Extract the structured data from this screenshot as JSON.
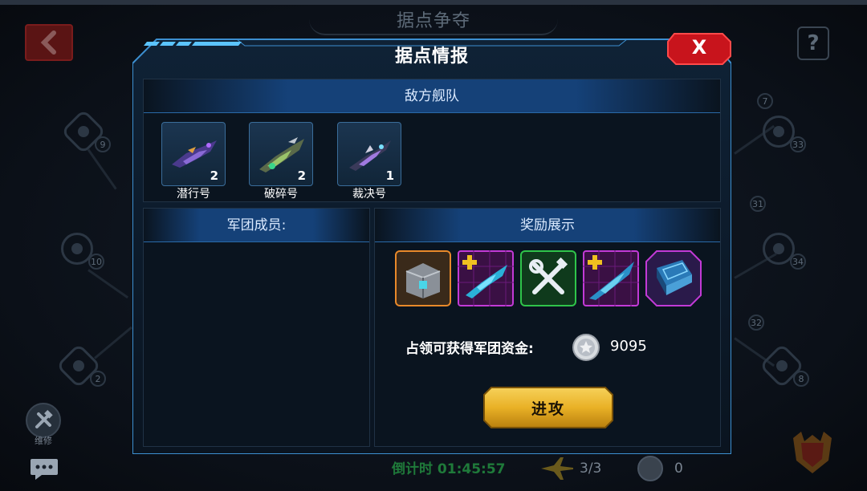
{
  "background": {
    "screen_title": "据点争夺",
    "help_glyph": "?",
    "nodes": [
      {
        "number": "9"
      },
      {
        "number": "10"
      },
      {
        "number": "2"
      },
      {
        "number": "7"
      },
      {
        "number": "33"
      },
      {
        "number": "31"
      },
      {
        "number": "34"
      },
      {
        "number": "32"
      },
      {
        "number": "8"
      }
    ],
    "repair_label": "维修",
    "countdown": "倒计时 01:45:57",
    "attempts": "3/3",
    "coins": "0"
  },
  "dialog": {
    "title": "据点情报",
    "close_label": "X",
    "enemy_fleet": {
      "header": "敌方舰队",
      "ships": [
        {
          "name": "潜行号",
          "count": "2",
          "icon": "purple-frigate-icon"
        },
        {
          "name": "破碎号",
          "count": "2",
          "icon": "green-cruiser-icon"
        },
        {
          "name": "裁决号",
          "count": "1",
          "icon": "violet-destroyer-icon"
        }
      ]
    },
    "members": {
      "header": "军团成员:"
    },
    "rewards": {
      "header": "奖励展示",
      "items": [
        {
          "icon": "supply-crate-icon",
          "rarity_color": "#e8892a"
        },
        {
          "icon": "ship-fragment-icon",
          "rarity_color": "#c23ad6"
        },
        {
          "icon": "repair-tools-icon",
          "rarity_color": "#2fc44a"
        },
        {
          "icon": "ship-fragment-icon",
          "rarity_color": "#c23ad6"
        },
        {
          "icon": "blueprint-book-icon",
          "rarity_color": "#c23ad6"
        }
      ],
      "fund_label": "占领可获得军团资金:",
      "fund_value": "9095"
    },
    "attack_label": "进攻"
  },
  "colors": {
    "accent_cyan": "#2f9fe8",
    "close_red": "#c8141c",
    "attack_gold": "#e9b126",
    "countdown_green": "#1f7a3a"
  }
}
